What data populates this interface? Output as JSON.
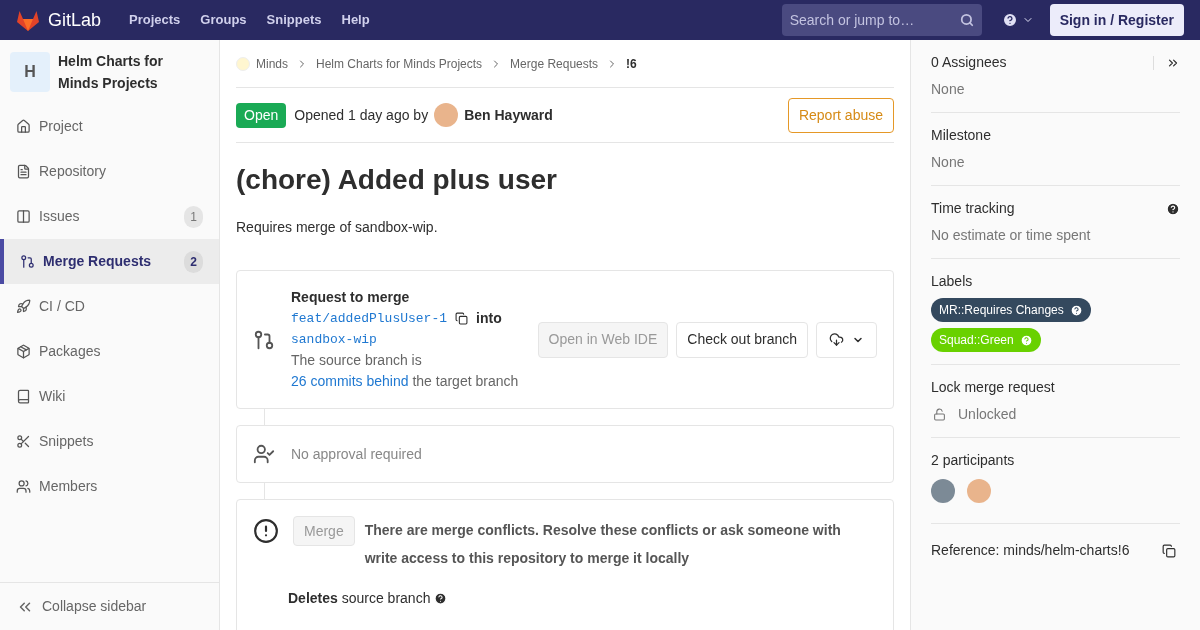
{
  "navbar": {
    "brand": "GitLab",
    "links": [
      "Projects",
      "Groups",
      "Snippets",
      "Help"
    ],
    "search": {
      "placeholder": "Search or jump to…"
    },
    "sign_in": "Sign in / Register"
  },
  "sidebar": {
    "project_initial": "H",
    "project_name": "Helm Charts for Minds Projects",
    "items": [
      {
        "kind": "home",
        "label": "Project",
        "selected": false
      },
      {
        "kind": "file",
        "label": "Repository",
        "selected": false
      },
      {
        "kind": "issues",
        "label": "Issues",
        "count": "1",
        "selected": false
      },
      {
        "kind": "merge",
        "label": "Merge Requests",
        "count": "2",
        "selected": true
      },
      {
        "kind": "rocket",
        "label": "CI / CD",
        "selected": false
      },
      {
        "kind": "package",
        "label": "Packages",
        "selected": false
      },
      {
        "kind": "book",
        "label": "Wiki",
        "selected": false
      },
      {
        "kind": "scissors",
        "label": "Snippets",
        "selected": false
      },
      {
        "kind": "users",
        "label": "Members",
        "selected": false
      }
    ],
    "collapse": "Collapse sidebar"
  },
  "breadcrumbs": [
    "Minds",
    "Helm Charts for Minds Projects",
    "Merge Requests",
    "!6"
  ],
  "header": {
    "status": "Open",
    "opened": "Opened 1 day ago by",
    "author": "Ben Hayward",
    "report": "Report abuse"
  },
  "title": "(chore) Added plus user",
  "description": "Requires merge of sandbox-wip.",
  "merge_widget": {
    "heading": "Request to merge",
    "source_branch": "feat/addedPlusUser-1",
    "into": "into",
    "target_branch": "sandbox-wip",
    "behind_prefix": "The source branch is",
    "behind_link": "26 commits behind",
    "behind_suffix": "the target branch",
    "web_ide": "Open in Web IDE",
    "checkout": "Check out branch"
  },
  "approval": "No approval required",
  "merge_box": {
    "button": "Merge",
    "message": "There are merge conflicts. Resolve these conflicts or ask someone with write access to this repository to merge it locally",
    "deletes": "**Deletes** source branch"
  },
  "right_sidebar": {
    "assignees": {
      "title": "0 Assignees",
      "value": "None"
    },
    "milestone": {
      "title": "Milestone",
      "value": "None"
    },
    "time_tracking": {
      "title": "Time tracking",
      "value": "No estimate or time spent"
    },
    "labels": {
      "title": "Labels",
      "items": [
        {
          "text": "MR::Requires Changes",
          "color": "#34495e"
        },
        {
          "text": "Squad::Green",
          "color": "#69d100"
        }
      ]
    },
    "lock": {
      "title": "Lock merge request",
      "value": "Unlocked"
    },
    "participants": {
      "title": "2 participants"
    },
    "reference": "Reference: minds/helm-charts!6"
  }
}
